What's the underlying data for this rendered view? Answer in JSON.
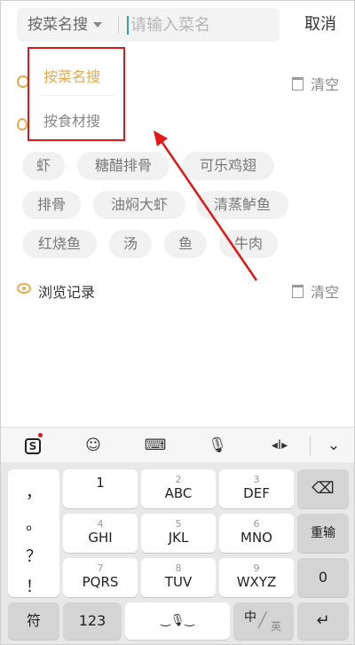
{
  "search": {
    "mode": "按菜名搜",
    "placeholder": "请输入菜名",
    "cancel": "取消"
  },
  "dropdown": {
    "items": [
      "按菜名搜",
      "按食材搜"
    ]
  },
  "history": {
    "clear": "清空"
  },
  "hot": {
    "tags": [
      "虾",
      "糖醋排骨",
      "可乐鸡翅",
      "排骨",
      "油焖大虾",
      "清蒸鲈鱼",
      "红烧鱼",
      "汤",
      "鱼",
      "牛肉"
    ]
  },
  "browse": {
    "title": "浏览记录",
    "clear": "清空"
  },
  "keyboard": {
    "punct": [
      "，",
      "。",
      "？",
      "！"
    ],
    "keys": [
      {
        "num": "",
        "label": "1"
      },
      {
        "num": "2",
        "label": "ABC"
      },
      {
        "num": "3",
        "label": "DEF"
      },
      {
        "num": "4",
        "label": "GHI"
      },
      {
        "num": "5",
        "label": "JKL"
      },
      {
        "num": "6",
        "label": "MNO"
      },
      {
        "num": "7",
        "label": "PQRS"
      },
      {
        "num": "8",
        "label": "TUV"
      },
      {
        "num": "9",
        "label": "WXYZ"
      }
    ],
    "retype": "重输",
    "zero": "0",
    "symbols": "符",
    "numbers": "123",
    "lang_cn": "中",
    "lang_en": "英"
  },
  "colors": {
    "accent": "#e9a94e",
    "highlight": "#e01818"
  }
}
